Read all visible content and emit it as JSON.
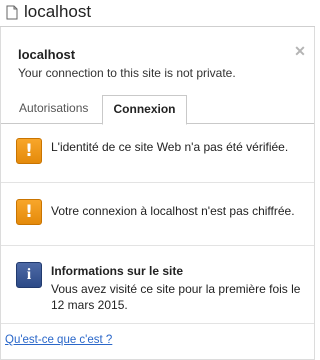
{
  "omnibox": {
    "url": "localhost",
    "icon": "page-icon"
  },
  "popup": {
    "site_name": "localhost",
    "connection_status": "Your connection to this site is not private.",
    "close_icon": "close-icon",
    "tabs": [
      {
        "label": "Autorisations",
        "active": false
      },
      {
        "label": "Connexion",
        "active": true
      }
    ],
    "items": [
      {
        "icon": "warning-icon",
        "text": "L'identité de ce site Web n'a pas été vérifiée."
      },
      {
        "icon": "warning-icon",
        "text": "Votre connexion à localhost n'est pas chiffrée."
      }
    ],
    "info": {
      "icon": "info-icon",
      "title": "Informations sur le site",
      "detail": "Vous avez visité ce site pour la première fois le 12 mars 2015."
    },
    "help_link": "Qu'est-ce que c'est ?"
  },
  "colors": {
    "warning": "#f29b1d",
    "info": "#3a5795",
    "link": "#2a67c9"
  }
}
